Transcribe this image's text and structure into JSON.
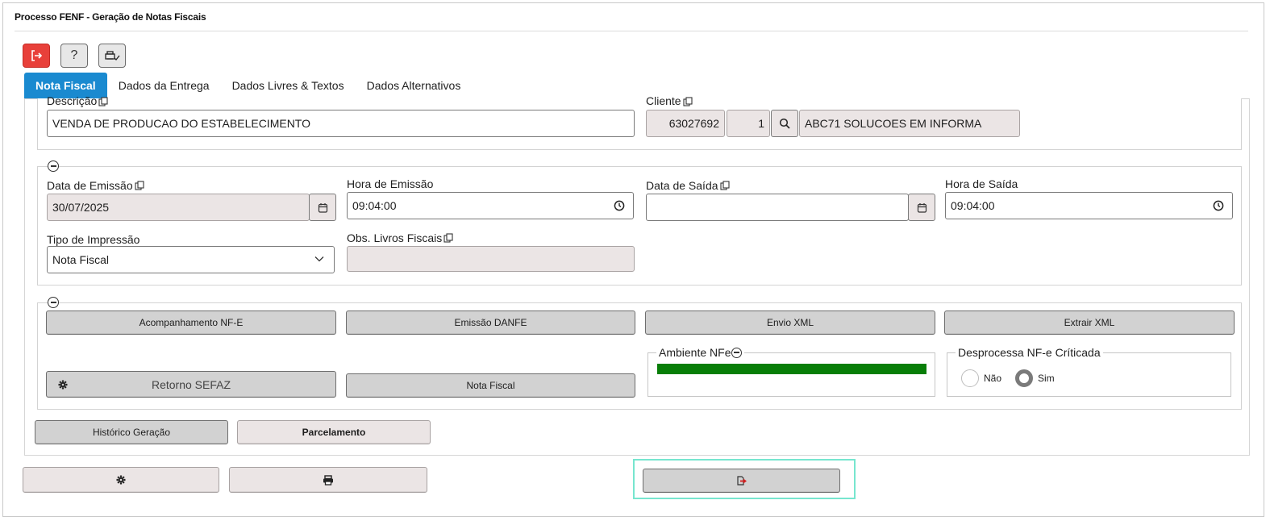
{
  "window": {
    "title": "Processo FENF - Geração de Notas Fiscais"
  },
  "toolbar": {
    "exit_icon": "exit-icon",
    "help_label": "?",
    "print_icon": "printer-sign-icon"
  },
  "tabs": [
    {
      "label": "Nota Fiscal",
      "active": true
    },
    {
      "label": "Dados da Entrega",
      "active": false
    },
    {
      "label": "Dados Livres & Textos",
      "active": false
    },
    {
      "label": "Dados Alternativos",
      "active": false
    }
  ],
  "header": {
    "descricao_label": "Descrição",
    "descricao_value": "VENDA DE PRODUCAO DO ESTABELECIMENTO",
    "cliente_label": "Cliente",
    "cliente_code": "63027692",
    "cliente_seq": "1",
    "cliente_name": "ABC71 SOLUCOES EM INFORMA"
  },
  "dates": {
    "data_emissao_label": "Data de Emissão",
    "data_emissao_value": "30/07/2025",
    "hora_emissao_label": "Hora de Emissão",
    "hora_emissao_value": "09:04:00",
    "data_saida_label": "Data de Saída",
    "data_saida_value": "",
    "hora_saida_label": "Hora de Saída",
    "hora_saida_value": "09:04:00",
    "tipo_impressao_label": "Tipo de Impressão",
    "tipo_impressao_value": "Nota Fiscal",
    "obs_livros_label": "Obs. Livros Fiscais",
    "obs_livros_value": ""
  },
  "actions": {
    "acompanhamento": "Acompanhamento NF-E",
    "emissao_danfe": "Emissão DANFE",
    "envio_xml": "Envio XML",
    "extrair_xml": "Extrair XML",
    "retorno_sefaz": "Retorno SEFAZ",
    "nota_fiscal": "Nota Fiscal",
    "ambiente_label": "Ambiente NFe",
    "ambiente_color": "#087e08",
    "desprocessa_label": "Desprocessa NF-e Críticada",
    "radio_nao": "Não",
    "radio_sim": "Sim",
    "radio_selected": "Sim"
  },
  "bottom": {
    "historico": "Histórico Geração",
    "parcelamento": "Parcelamento"
  },
  "footer": {
    "settings_icon": "gear-icon",
    "print_icon": "printer-icon",
    "exit_icon": "exit-doc-icon"
  },
  "colors": {
    "accent": "#1a8ad0",
    "danger": "#e8403a",
    "focus": "#77e6cf"
  }
}
